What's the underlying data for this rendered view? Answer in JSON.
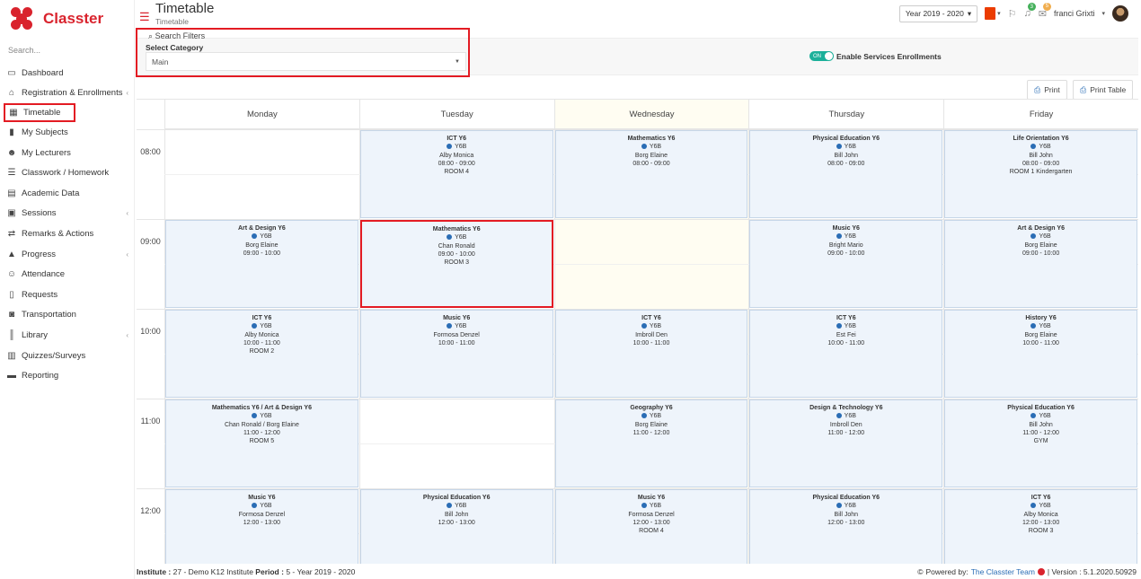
{
  "brand": {
    "name": "Classter"
  },
  "search": {
    "placeholder": "Search..."
  },
  "nav": [
    {
      "label": "Dashboard",
      "icon": "laptop-icon",
      "glyph": "▭",
      "caret": false
    },
    {
      "label": "Registration & Enrollments",
      "icon": "bank-icon",
      "glyph": "⌂",
      "caret": true
    },
    {
      "label": "Timetable",
      "icon": "calendar-icon",
      "glyph": "▦",
      "caret": false,
      "active": true
    },
    {
      "label": "My Subjects",
      "icon": "book-icon",
      "glyph": "▮",
      "caret": false
    },
    {
      "label": "My Lecturers",
      "icon": "users-icon",
      "glyph": "☻",
      "caret": false
    },
    {
      "label": "Classwork / Homework",
      "icon": "list-icon",
      "glyph": "☰",
      "caret": false
    },
    {
      "label": "Academic Data",
      "icon": "id-card-icon",
      "glyph": "▤",
      "caret": false
    },
    {
      "label": "Sessions",
      "icon": "presentation-icon",
      "glyph": "▣",
      "caret": true
    },
    {
      "label": "Remarks & Actions",
      "icon": "shuffle-icon",
      "glyph": "⇄",
      "caret": false
    },
    {
      "label": "Progress",
      "icon": "graduation-cap-icon",
      "glyph": "▲",
      "caret": true
    },
    {
      "label": "Attendance",
      "icon": "user-check-icon",
      "glyph": "☺",
      "caret": false
    },
    {
      "label": "Requests",
      "icon": "file-icon",
      "glyph": "▯",
      "caret": false
    },
    {
      "label": "Transportation",
      "icon": "bus-icon",
      "glyph": "◙",
      "caret": false
    },
    {
      "label": "Library",
      "icon": "books-icon",
      "glyph": "║",
      "caret": true
    },
    {
      "label": "Quizzes/Surveys",
      "icon": "clipboard-icon",
      "glyph": "▥",
      "caret": false
    },
    {
      "label": "Reporting",
      "icon": "printer-icon",
      "glyph": "▬",
      "caret": false
    }
  ],
  "header": {
    "title": "Timetable",
    "subtitle": "Timetable",
    "year": "Year 2019 - 2020",
    "user": "franci Grixti",
    "notif_count": "3",
    "mail_count": "5"
  },
  "filters": {
    "toggle_label": "Search Filters",
    "category_label": "Select Category",
    "category_value": "Main",
    "switch_state": "ON",
    "switch_label": "Enable Services Enrollments"
  },
  "actions": {
    "print": "Print",
    "print_table": "Print Table"
  },
  "timetable": {
    "days": [
      "Monday",
      "Tuesday",
      "Wednesday",
      "Thursday",
      "Friday"
    ],
    "today_index": 2,
    "times": [
      "08:00",
      "09:00",
      "10:00",
      "11:00",
      "12:00"
    ],
    "lessons": [
      {
        "day": 1,
        "slot": 0,
        "subject": "ICT Y6",
        "group": "Y6B",
        "teacher": "Alby Monica",
        "time": "08:00 - 09:00",
        "room": "ROOM 4"
      },
      {
        "day": 2,
        "slot": 0,
        "subject": "Mathematics Y6",
        "group": "Y6B",
        "teacher": "Borg Elaine",
        "time": "08:00 - 09:00",
        "room": ""
      },
      {
        "day": 3,
        "slot": 0,
        "subject": "Physical Education Y6",
        "group": "Y6B",
        "teacher": "Bill John",
        "time": "08:00 - 09:00",
        "room": ""
      },
      {
        "day": 4,
        "slot": 0,
        "subject": "Life Orientation Y6",
        "group": "Y6B",
        "teacher": "Bill John",
        "time": "08:00 - 09:00",
        "room": "ROOM 1 Kindergarten"
      },
      {
        "day": 0,
        "slot": 1,
        "subject": "Art & Design Y6",
        "group": "Y6B",
        "teacher": "Borg Elaine",
        "time": "09:00 - 10:00",
        "room": ""
      },
      {
        "day": 1,
        "slot": 1,
        "subject": "Mathematics Y6",
        "group": "Y6B",
        "teacher": "Chan Ronald",
        "time": "09:00 - 10:00",
        "room": "ROOM 3",
        "highlight": true
      },
      {
        "day": 3,
        "slot": 1,
        "subject": "Music Y6",
        "group": "Y6B",
        "teacher": "Bright Mario",
        "time": "09:00 - 10:00",
        "room": ""
      },
      {
        "day": 4,
        "slot": 1,
        "subject": "Art & Design Y6",
        "group": "Y6B",
        "teacher": "Borg Elaine",
        "time": "09:00 - 10:00",
        "room": ""
      },
      {
        "day": 0,
        "slot": 2,
        "subject": "ICT Y6",
        "group": "Y6B",
        "teacher": "Alby Monica",
        "time": "10:00 - 11:00",
        "room": "ROOM 2"
      },
      {
        "day": 1,
        "slot": 2,
        "subject": "Music Y6",
        "group": "Y6B",
        "teacher": "Formosa Denzel",
        "time": "10:00 - 11:00",
        "room": ""
      },
      {
        "day": 2,
        "slot": 2,
        "subject": "ICT Y6",
        "group": "Y6B",
        "teacher": "Imbroll Den",
        "time": "10:00 - 11:00",
        "room": ""
      },
      {
        "day": 3,
        "slot": 2,
        "subject": "ICT Y6",
        "group": "Y6B",
        "teacher": "Est Fei",
        "time": "10:00 - 11:00",
        "room": ""
      },
      {
        "day": 4,
        "slot": 2,
        "subject": "History Y6",
        "group": "Y6B",
        "teacher": "Borg Elaine",
        "time": "10:00 - 11:00",
        "room": ""
      },
      {
        "day": 0,
        "slot": 3,
        "subject": "Mathematics Y6 / Art & Design Y6",
        "group": "Y6B",
        "teacher": "Chan Ronald / Borg Elaine",
        "time": "11:00 - 12:00",
        "room": "ROOM 5"
      },
      {
        "day": 2,
        "slot": 3,
        "subject": "Geography Y6",
        "group": "Y6B",
        "teacher": "Borg Elaine",
        "time": "11:00 - 12:00",
        "room": ""
      },
      {
        "day": 3,
        "slot": 3,
        "subject": "Design & Technology Y6",
        "group": "Y6B",
        "teacher": "Imbroll Den",
        "time": "11:00 - 12:00",
        "room": ""
      },
      {
        "day": 4,
        "slot": 3,
        "subject": "Physical Education Y6",
        "group": "Y6B",
        "teacher": "Bill John",
        "time": "11:00 - 12:00",
        "room": "GYM"
      },
      {
        "day": 0,
        "slot": 4,
        "subject": "Music Y6",
        "group": "Y6B",
        "teacher": "Formosa Denzel",
        "time": "12:00 - 13:00",
        "room": ""
      },
      {
        "day": 1,
        "slot": 4,
        "subject": "Physical Education Y6",
        "group": "Y6B",
        "teacher": "Bill John",
        "time": "12:00 - 13:00",
        "room": ""
      },
      {
        "day": 2,
        "slot": 4,
        "subject": "Music Y6",
        "group": "Y6B",
        "teacher": "Formosa Denzel",
        "time": "12:00 - 13:00",
        "room": "ROOM 4"
      },
      {
        "day": 3,
        "slot": 4,
        "subject": "Physical Education Y6",
        "group": "Y6B",
        "teacher": "Bill John",
        "time": "12:00 - 13:00",
        "room": ""
      },
      {
        "day": 4,
        "slot": 4,
        "subject": "ICT Y6",
        "group": "Y6B",
        "teacher": "Alby Monica",
        "time": "12:00 - 13:00",
        "room": "ROOM 3"
      }
    ]
  },
  "footer": {
    "institute_label": "Institute :",
    "institute_value": "27 - Demo K12 Institute",
    "period_label": "Period :",
    "period_value": "5 - Year 2019 - 2020",
    "powered_label": "Powered by:",
    "team": "The Classter Team",
    "version": "| Version : 5.1.2020.50929"
  },
  "colors": {
    "brand": "#d9232d",
    "accent": "#2a6db5",
    "switch": "#1cb09a",
    "highlight": "#e31b23"
  }
}
